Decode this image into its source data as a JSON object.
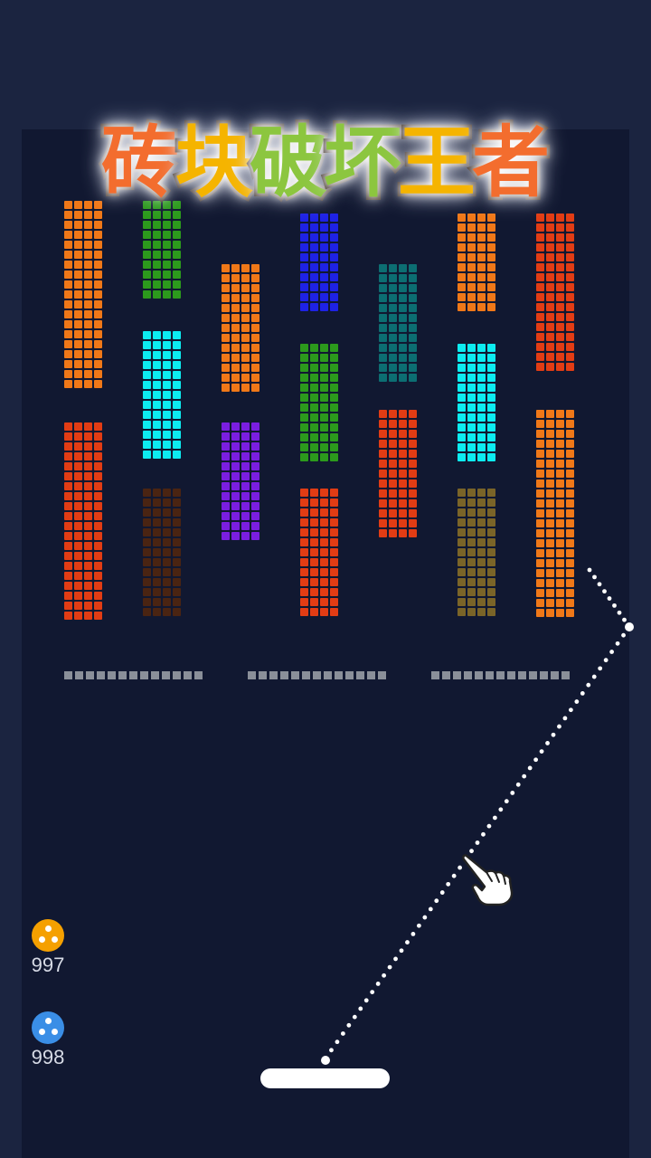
{
  "title": {
    "chars": [
      {
        "text": "砖",
        "color": "#f36d2e"
      },
      {
        "text": "块",
        "color": "#f5b400"
      },
      {
        "text": "破",
        "color": "#8cc63f"
      },
      {
        "text": "坏",
        "color": "#8cc63f"
      },
      {
        "text": "王",
        "color": "#f5b400"
      },
      {
        "text": "者",
        "color": "#f36d2e"
      }
    ]
  },
  "colors": {
    "background": "#1b2440",
    "playfield": "#111831",
    "barrier": "#8a8f99",
    "paddle": "#ffffff"
  },
  "brick_blocks": [
    {
      "name": "orange-column-1",
      "color": "#f07818"
    },
    {
      "name": "green-column-2",
      "color": "#2c9a1c"
    },
    {
      "name": "orange-column-3",
      "color": "#f07818"
    },
    {
      "name": "blue-column-4",
      "color": "#1e22e6"
    },
    {
      "name": "teal-column-5",
      "color": "#0c6e72"
    },
    {
      "name": "orange-column-6",
      "color": "#f07818"
    },
    {
      "name": "red-column-7",
      "color": "#e23c14"
    },
    {
      "name": "cyan-column-2",
      "color": "#0cecf0"
    },
    {
      "name": "green-column-4",
      "color": "#2c9a1c"
    },
    {
      "name": "cyan-column-6",
      "color": "#0cecf0"
    },
    {
      "name": "red-column-1",
      "color": "#e23c14"
    },
    {
      "name": "purple-column-3",
      "color": "#7a1ee0"
    },
    {
      "name": "red-column-5",
      "color": "#e23c14"
    },
    {
      "name": "orange-column-7",
      "color": "#f07818"
    },
    {
      "name": "brown-column-2",
      "color": "#4a2412"
    },
    {
      "name": "red-column-4",
      "color": "#e23c14"
    },
    {
      "name": "olive-column-6",
      "color": "#7a6428"
    }
  ],
  "barriers": [
    "barrier-left",
    "barrier-middle",
    "barrier-right"
  ],
  "ball_counters": [
    {
      "name": "orange-ball-counter",
      "color": "#f5a000",
      "count": "997"
    },
    {
      "name": "blue-ball-counter",
      "color": "#3a8ee6",
      "count": "998"
    }
  ],
  "icons": {
    "hand": "pointing-hand-icon",
    "ball_type": "ball-cluster-icon"
  }
}
